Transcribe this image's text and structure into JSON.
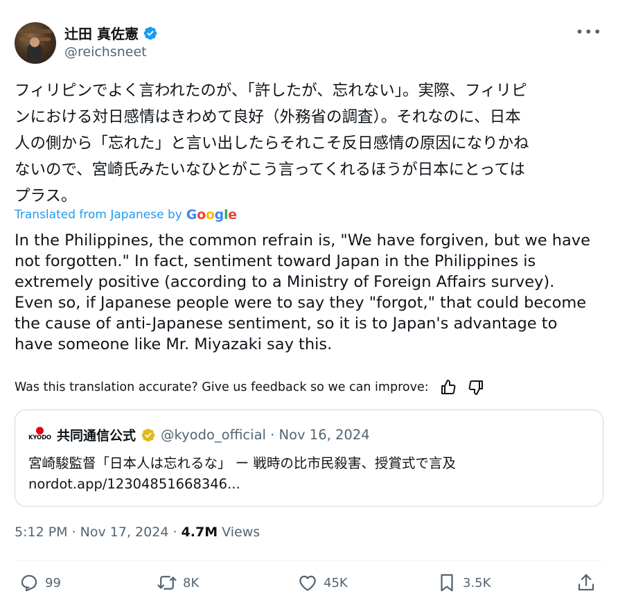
{
  "author": {
    "display_name": "辻田 真佐憲",
    "handle": "@reichsneet"
  },
  "more_label": "•••",
  "tweet": {
    "text_lines": [
      "フィリピンでよく言われたのが、「許したが、忘れない」。実際、フィリピ",
      "ンにおける対日感情はきわめて良好（外務省の調査）。それなのに、日本",
      "人の側から「忘れた」と言い出したらそれこそ反日感情の原因になりかね",
      "ないので、宮崎氏みたいなひとがこう言ってくれるほうが日本にとっては",
      "プラス。"
    ]
  },
  "translation": {
    "label": "Translated from Japanese by",
    "provider": "Google",
    "lines": [
      "In the Philippines, the common refrain is, \"We have forgiven, but we have",
      "not forgotten.\" In fact, sentiment toward Japan in the Philippines is",
      "extremely positive (according to a Ministry of Foreign Affairs survey).",
      "Even so, if Japanese people were to say they \"forgot,\" that could become",
      "the cause of anti-Japanese sentiment, so it is to Japan's advantage to",
      "have someone like Mr. Miyazaki say this."
    ],
    "feedback_prompt": "Was this translation accurate? Give us feedback so we can improve:"
  },
  "quoted": {
    "logo_text": "KYODO",
    "name": "共同通信公式",
    "handle_date": "@kyodo_official · Nov 16, 2024",
    "text_line1": "宮崎駿監督「日本人は忘れるな」 ー 戦時の比市民殺害、授賞式で言及",
    "text_line2": "nordot.app/12304851668346..."
  },
  "meta": {
    "time_date": "5:12 PM · Nov 17, 2024 · ",
    "views_count": "4.7M",
    "views_label": " Views"
  },
  "actions": {
    "replies": "99",
    "reposts": "8K",
    "likes": "45K",
    "bookmarks": "3.5K"
  },
  "colors": {
    "link_blue": "#1d9bf0",
    "secondary_text": "#536471",
    "verified_blue": "#1d9bf0",
    "verified_gold": "#e2b719"
  }
}
